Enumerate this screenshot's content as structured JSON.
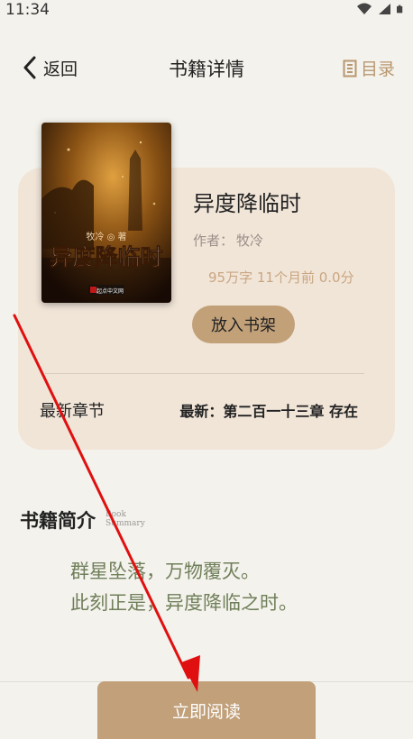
{
  "status_bar": {
    "time": "11:34",
    "icons": [
      "wifi-icon",
      "signal-icon",
      "battery-icon"
    ]
  },
  "nav": {
    "back_label": "返回",
    "title": "书籍详情",
    "toc_label": "目录"
  },
  "book": {
    "title": "异度降临时",
    "author_label": "作者：",
    "author_name": "牧冷",
    "meta": "95万字  11个月前  0.0分",
    "add_shelf_label": "放入书架",
    "latest_label": "最新章节",
    "latest_value": "最新：第二百一十三章 存在",
    "cover": {
      "title_text": "异度降临时",
      "author_text": "牧冷 ◎ 著",
      "publisher_text": "起点中文网"
    }
  },
  "summary": {
    "title": "书籍简介",
    "title_english": "Book Summary",
    "lines": [
      "群星坠落，万物覆灭。",
      "此刻正是，异度降临之时。"
    ]
  },
  "actions": {
    "read_now_label": "立即阅读"
  },
  "colors": {
    "background": "#f4f2ec",
    "card": "#f1e5d8",
    "accent": "#c1a07a",
    "summary_text": "#6f7f5a",
    "annotation_arrow": "#e01010"
  }
}
